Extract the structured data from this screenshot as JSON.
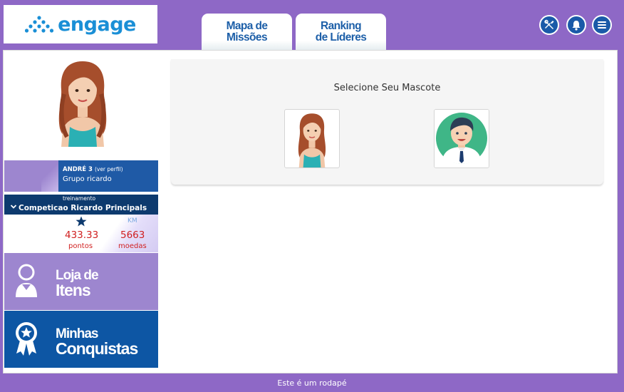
{
  "brand": {
    "name": "engage"
  },
  "nav": {
    "tab_missions": "Mapa de\nMissões",
    "tab_ranking": "Ranking\nde Líderes"
  },
  "header_icons": [
    "tools-icon",
    "bell-icon",
    "menu-icon"
  ],
  "profile": {
    "name": "ANDRÉ 3",
    "view_profile": "(ver perfil)",
    "group": "Grupo ricardo"
  },
  "competition": {
    "label": "treinamento",
    "title": "Competicao Ricardo Principals"
  },
  "stats": {
    "km_label": "KM",
    "points_value": "433.33",
    "points_label": "pontos",
    "coins_value": "5663",
    "coins_label": "moedas"
  },
  "menu": {
    "shop_line1": "Loja de",
    "shop_line2": "Itens",
    "achievements_line1": "Minhas",
    "achievements_line2": "Conquistas"
  },
  "content": {
    "title": "Selecione Seu Mascote",
    "mascots": [
      "female-mascot",
      "male-mascot"
    ]
  },
  "footer": {
    "text": "Este é um rodapé"
  },
  "colors": {
    "background": "#8e68c6",
    "primary_blue": "#1f5aa6",
    "dark_blue": "#0d3a6e",
    "lilac": "#9d86cf",
    "value_red": "#d01f1f"
  }
}
